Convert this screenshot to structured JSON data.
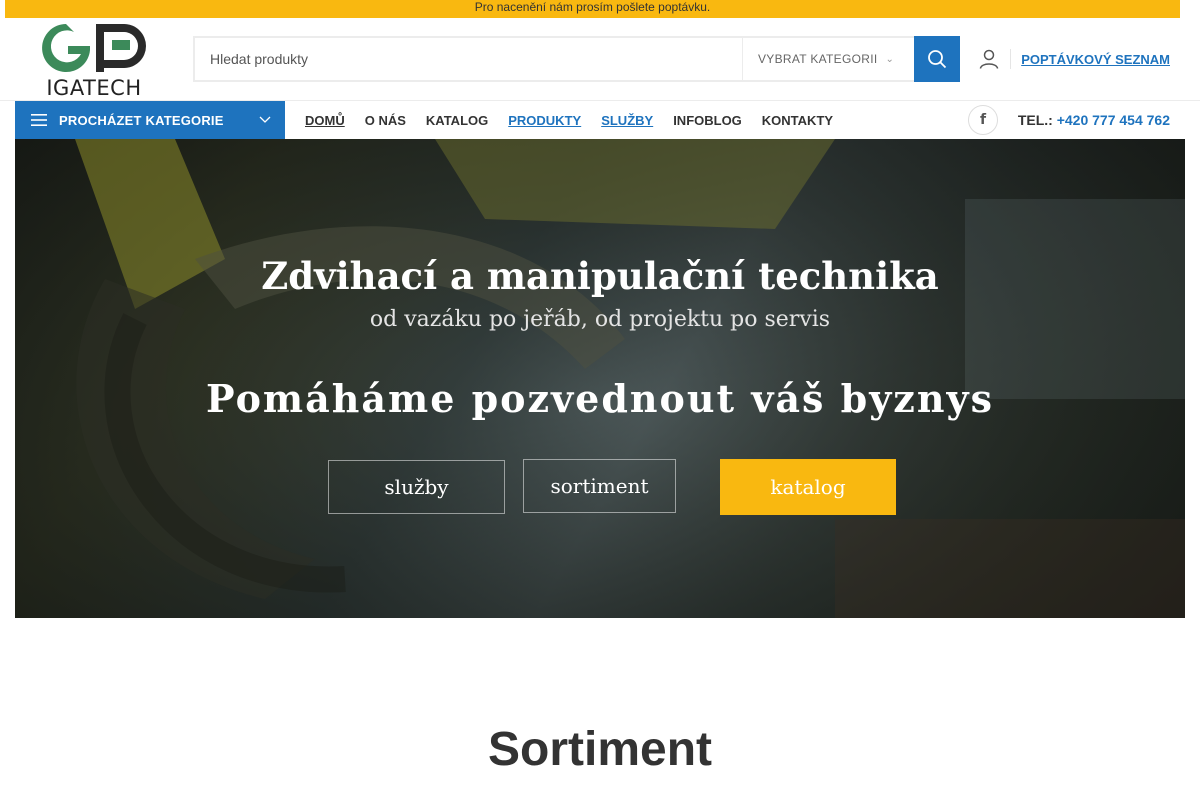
{
  "topbar": {
    "text": "Pro nacenění nám prosím pošlete poptávku."
  },
  "logo": {
    "text": "IGATECH",
    "colors": {
      "green": "#3c8a5a",
      "dark": "#2a2a2a"
    }
  },
  "search": {
    "placeholder": "Hledat produkty",
    "category_label": "VYBRAT KATEGORII",
    "button_icon": "search-icon"
  },
  "header": {
    "user_icon": "user-icon",
    "rfq_label": "POPTÁVKOVÝ SEZNAM"
  },
  "catbar": {
    "label": "PROCHÁZET KATEGORIE",
    "icon": "hamburger-icon"
  },
  "nav": {
    "items": [
      {
        "label": "DOMŮ"
      },
      {
        "label": "O NÁS"
      },
      {
        "label": "KATALOG"
      },
      {
        "label": "PRODUKTY"
      },
      {
        "label": "SLUŽBY"
      },
      {
        "label": "INFOBLOG"
      },
      {
        "label": "KONTAKTY"
      }
    ]
  },
  "social": {
    "facebook_glyph": "f"
  },
  "phone": {
    "label": "TEL.:",
    "number": "+420 777 454 762"
  },
  "hero": {
    "title": "Zdvihací a manipulační technika",
    "subtitle": "od vazáku po jeřáb, od projektu po servis",
    "claim": "Pomáháme pozvednout váš byznys",
    "buttons": [
      {
        "label": "služby"
      },
      {
        "label": "sortiment"
      },
      {
        "label": "katalog"
      }
    ]
  },
  "section": {
    "title": "Sortiment"
  },
  "colors": {
    "accent_yellow": "#f9b810",
    "brand_blue": "#1e73be"
  }
}
